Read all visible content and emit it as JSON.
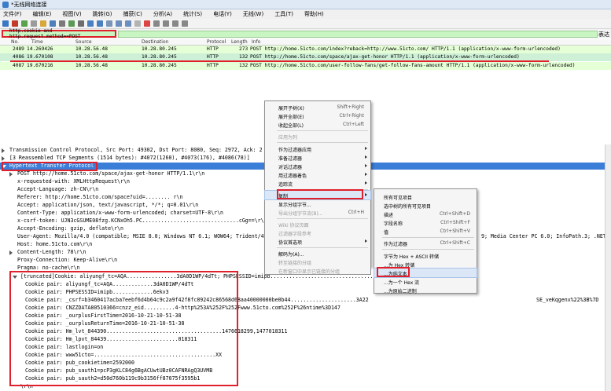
{
  "window": {
    "title": "*无线网络连接"
  },
  "menubar": [
    "文件(F)",
    "编辑(E)",
    "视图(V)",
    "跳转(G)",
    "捕获(C)",
    "分析(A)",
    "统计(S)",
    "电话(Y)",
    "无线(W)",
    "工具(T)",
    "帮助(H)"
  ],
  "filter": {
    "value": "http.cookie and http.request.method==POST",
    "expression_label": "表达"
  },
  "packet_list": {
    "headers": {
      "no": "No.",
      "time": "Time",
      "source": "Source",
      "destination": "Destination",
      "protocol": "Protocol",
      "length": "Length",
      "info": "Info"
    },
    "rows": [
      {
        "no": "2489",
        "time": "14.269426",
        "source": "10.28.56.48",
        "destination": "10.28.80.245",
        "protocol": "HTTP",
        "length": "273",
        "info": "POST http://home.51cto.com/index?reback=http://www.51cto.com/ HTTP/1.1  (application/x-www-form-urlencoded)"
      },
      {
        "no": "4086",
        "time": "19.670108",
        "source": "10.28.56.48",
        "destination": "10.28.80.245",
        "protocol": "HTTP",
        "length": "132",
        "info": "POST http://home.51cto.com/space/ajax-get-honor HTTP/1.1  (application/x-www-form-urlencoded)"
      },
      {
        "no": "4087",
        "time": "19.670216",
        "source": "10.28.56.48",
        "destination": "10.28.80.245",
        "protocol": "HTTP",
        "length": "132",
        "info": "POST http://home.51cto.com/user-follow-fans/get-follow-fans-amount HTTP/1.1  (application/x-www-form-urlencoded)"
      }
    ]
  },
  "details": {
    "tcp": "Transmission Control Protocol, Src Port: 49302, Dst Port: 8080, Seq: 2972, Ack: 2",
    "reassembled": "[3 Reassembled TCP Segments (1514 bytes): #4072(1260), #4073(176), #4086(78)]",
    "http": "Hypertext Transfer Protocol",
    "lines": [
      "POST http://home.51cto.com/space/ajax-get-honor HTTP/1.1\\r\\n",
      "x-requested-with: XMLHttpRequest\\r\\n",
      "Accept-Language: zh-CN\\r\\n",
      "Referer: http://home.51cto.com/space?uid=........ r\\n",
      "Accept: application/json, text/javascript, */*; q=0.01\\r\\n",
      "Content-Type: application/x-www-form-urlencoded; charset=UTF-8\\r\\n",
      "x-csrf-token: UJN3cGSUME08fzg.KCNxOh5.PC...............................cGg==\\r\\n",
      "Accept-Encoding: gzip, deflate\\r\\n",
      "User-Agent: Mozilla/4.0 (compatible; MSIE 8.0; Windows NT 6.1; WOW64; Trident/4",
      "Host: home.51cto.com\\r\\n",
      "Content-Length: 78\\r\\n",
      "Proxy-Connection: Keep-Alive\\r\\n",
      "Pragma: no-cache\\r\\n"
    ],
    "useragent_tail": "9; Media Center PC 6.0; InfoPath.3; .NET4",
    "cookie_header": "[truncated]Cookie: aliyungf_tc=AQA................3dA0D1WP/4dTt; PHPSESSID=imipb.................................................29242",
    "cookie_pairs": [
      "Cookie pair: aliyungf_tc=AQA.............3dA0D1WP/4dTt",
      "Cookie pair: PHPSESSID=imipb.............6ekv3",
      "Cookie pair: _csrf=b3460417acba7eebf6d4b64c9c2a9f42f8fc89242c86568d68aa40000000be0b44.....................3A22",
      "Cookie pair: CNZZDATA80510366=cnzz_eid..........4-http%253A%252F%252Fwww.51cto.com%252F%26ntime%3D147",
      "Cookie pair: _ourplusFirstTime=2016-10-21-10-51-38",
      "Cookie pair: _ourplusReturnTime=2016-10-21-10-51-38",
      "Cookie pair: Hm_lvt_844390.....................................1476618299,1477018311",
      "Cookie pair: Hm_lpvt_84439.......................018311",
      "Cookie pair: lastlogin=on",
      "Cookie pair: www51cto=.......................................XX",
      "Cookie pair: pub_cookietime=2592000",
      "Cookie pair: pub_sauth1=pcP3gKLC84g6BgACUwtUBz0CAFNRAgQ3UVMB",
      "Cookie pair: pub_sauth2=d50d760b119c9b3156ff87075f3595b1"
    ],
    "cookie_tail_1": "SE_veKqgenx%22%3B%7D",
    "footer_line": "\\r\\n"
  },
  "context_menu": {
    "items": [
      {
        "label": "展开子树(X)",
        "shortcut": "Shift+Right",
        "disabled": false
      },
      {
        "label": "展开全部(E)",
        "shortcut": "Ctrl+Right",
        "disabled": false
      },
      {
        "label": "收起全部(L)",
        "shortcut": "Ctrl+Left",
        "disabled": false
      },
      {
        "label": "应用为列",
        "shortcut": "",
        "disabled": true
      },
      {
        "label": "作为过滤器应用",
        "shortcut": "",
        "disabled": false,
        "submenu": true
      },
      {
        "label": "准备过滤器",
        "shortcut": "",
        "disabled": false,
        "submenu": true
      },
      {
        "label": "对话过滤器",
        "shortcut": "",
        "disabled": false,
        "submenu": true
      },
      {
        "label": "用过滤器着色",
        "shortcut": "",
        "disabled": false,
        "submenu": true
      },
      {
        "label": "追踪流",
        "shortcut": "",
        "disabled": false,
        "submenu": true
      },
      {
        "label": "复制",
        "shortcut": "",
        "disabled": false,
        "submenu": true
      },
      {
        "label": "显示分组字节...",
        "shortcut": "",
        "disabled": false
      },
      {
        "label": "导出分组字节流(B)...",
        "shortcut": "Ctrl+H",
        "disabled": true
      },
      {
        "label": "Wiki 协议页面",
        "shortcut": "",
        "disabled": true
      },
      {
        "label": "过滤器字段参考",
        "shortcut": "",
        "disabled": true
      },
      {
        "label": "协议首选项",
        "shortcut": "",
        "disabled": false,
        "submenu": true
      },
      {
        "label": "解码为(A)...",
        "shortcut": "",
        "disabled": false
      },
      {
        "label": "转至链接的分组",
        "shortcut": "",
        "disabled": true
      },
      {
        "label": "在新窗口中显示已链接的分组",
        "shortcut": "",
        "disabled": true
      }
    ]
  },
  "copy_submenu": {
    "items": [
      {
        "label": "所有可见项目",
        "shortcut": "",
        "disabled": false
      },
      {
        "label": "选中树的所有可见项目",
        "shortcut": "",
        "disabled": false
      },
      {
        "label": "描述",
        "shortcut": "Ctrl+Shift+D",
        "disabled": false
      },
      {
        "label": "字段名称",
        "shortcut": "Ctrl+Shift+F",
        "disabled": false
      },
      {
        "label": "值",
        "shortcut": "Ctrl+Shift+V",
        "disabled": false
      },
      {
        "label": "作为过滤器",
        "shortcut": "Ctrl+Shift+C",
        "disabled": false
      },
      {
        "label": "字节为 Hex + ASCII 转储",
        "shortcut": "",
        "disabled": false
      },
      {
        "label": "...为 Hex 转储",
        "shortcut": "",
        "disabled": false
      },
      {
        "label": "...为纯文本",
        "shortcut": "",
        "disabled": false,
        "active": true
      },
      {
        "label": "...为一个 Hex 流",
        "shortcut": "",
        "disabled": false
      },
      {
        "label": "...为原始二进制",
        "shortcut": "",
        "disabled": false
      }
    ]
  },
  "colors": {
    "highlight": "#3b7ed8",
    "annotation_red": "#e0202a",
    "row_green": "#e5ffd6",
    "filter_green": "#c9f5c3"
  }
}
